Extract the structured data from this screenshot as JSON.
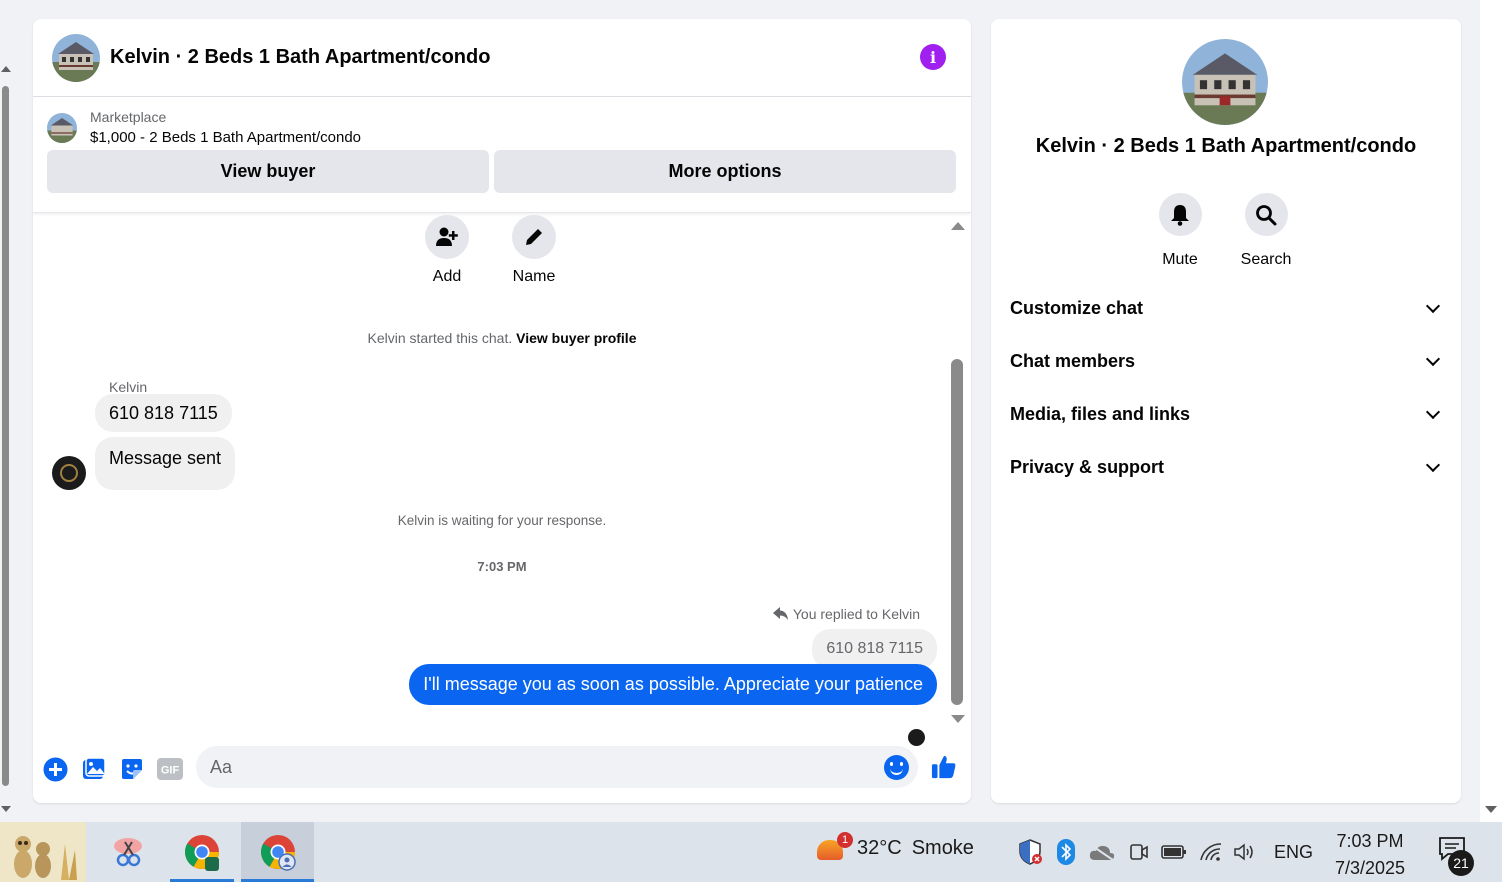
{
  "chat": {
    "title": "Kelvin · 2 Beds 1 Bath Apartment/condo",
    "info_icon": "i",
    "marketplace_label": "Marketplace",
    "listing": "$1,000 - 2 Beds 1 Bath Apartment/condo",
    "view_buyer": "View buyer",
    "more_options": "More options",
    "actions": {
      "add": "Add",
      "name": "Name"
    },
    "started_text": "Kelvin started this chat.",
    "view_profile": "View buyer profile",
    "sender": "Kelvin",
    "messages_in": [
      "610 818 7115",
      "Message sent"
    ],
    "waiting_text": "Kelvin is waiting for your response.",
    "timestamp": "7:03 PM",
    "reply_note": "You replied to Kelvin",
    "reply_quote": "610 818 7115",
    "message_out": "I'll message you as soon as possible. Appreciate your patience",
    "composer_placeholder": "Aa"
  },
  "info": {
    "title": "Kelvin · 2 Beds 1 Bath Apartment/condo",
    "mute": "Mute",
    "search": "Search",
    "sections": [
      "Customize chat",
      "Chat members",
      "Media, files and links",
      "Privacy & support"
    ]
  },
  "taskbar": {
    "weather_badge": "1",
    "temperature": "32°C",
    "condition": "Smoke",
    "language": "ENG",
    "time": "7:03 PM",
    "date": "7/3/2025",
    "notifications": "21"
  },
  "colors": {
    "accent": "#0a66f0",
    "info": "#a020f0",
    "bubble_in": "#f0f0f0",
    "panel_bg": "#ffffff"
  }
}
